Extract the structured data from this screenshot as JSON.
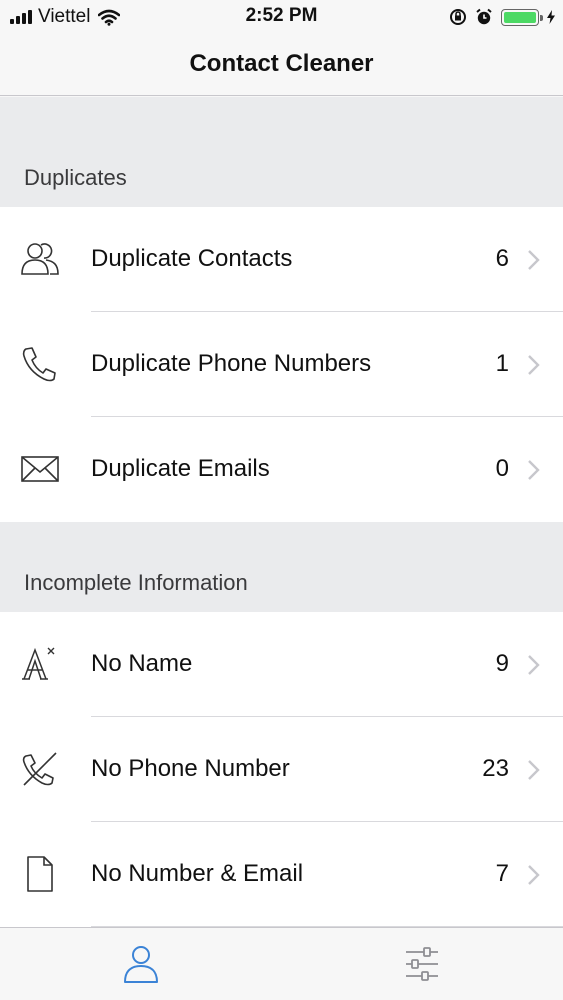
{
  "status_bar": {
    "carrier": "Viettel",
    "time": "2:52 PM"
  },
  "nav": {
    "title": "Contact Cleaner"
  },
  "sections": [
    {
      "header": "Duplicates",
      "rows": [
        {
          "icon": "people-icon",
          "label": "Duplicate Contacts",
          "count": "6"
        },
        {
          "icon": "phone-icon",
          "label": "Duplicate Phone Numbers",
          "count": "1"
        },
        {
          "icon": "envelope-icon",
          "label": "Duplicate Emails",
          "count": "0"
        }
      ]
    },
    {
      "header": "Incomplete Information",
      "rows": [
        {
          "icon": "no-name-icon",
          "label": "No Name",
          "count": "9"
        },
        {
          "icon": "no-phone-icon",
          "label": "No Phone Number",
          "count": "23"
        },
        {
          "icon": "document-icon",
          "label": "No Number & Email",
          "count": "7"
        }
      ]
    }
  ],
  "tabs": [
    {
      "icon": "contacts-tab-icon",
      "active": true
    },
    {
      "icon": "settings-sliders-icon",
      "active": false
    }
  ],
  "colors": {
    "accent": "#3b83d6",
    "battery": "#4cd964",
    "section_bg": "#eaebed",
    "chevron": "#c7c7cc"
  }
}
